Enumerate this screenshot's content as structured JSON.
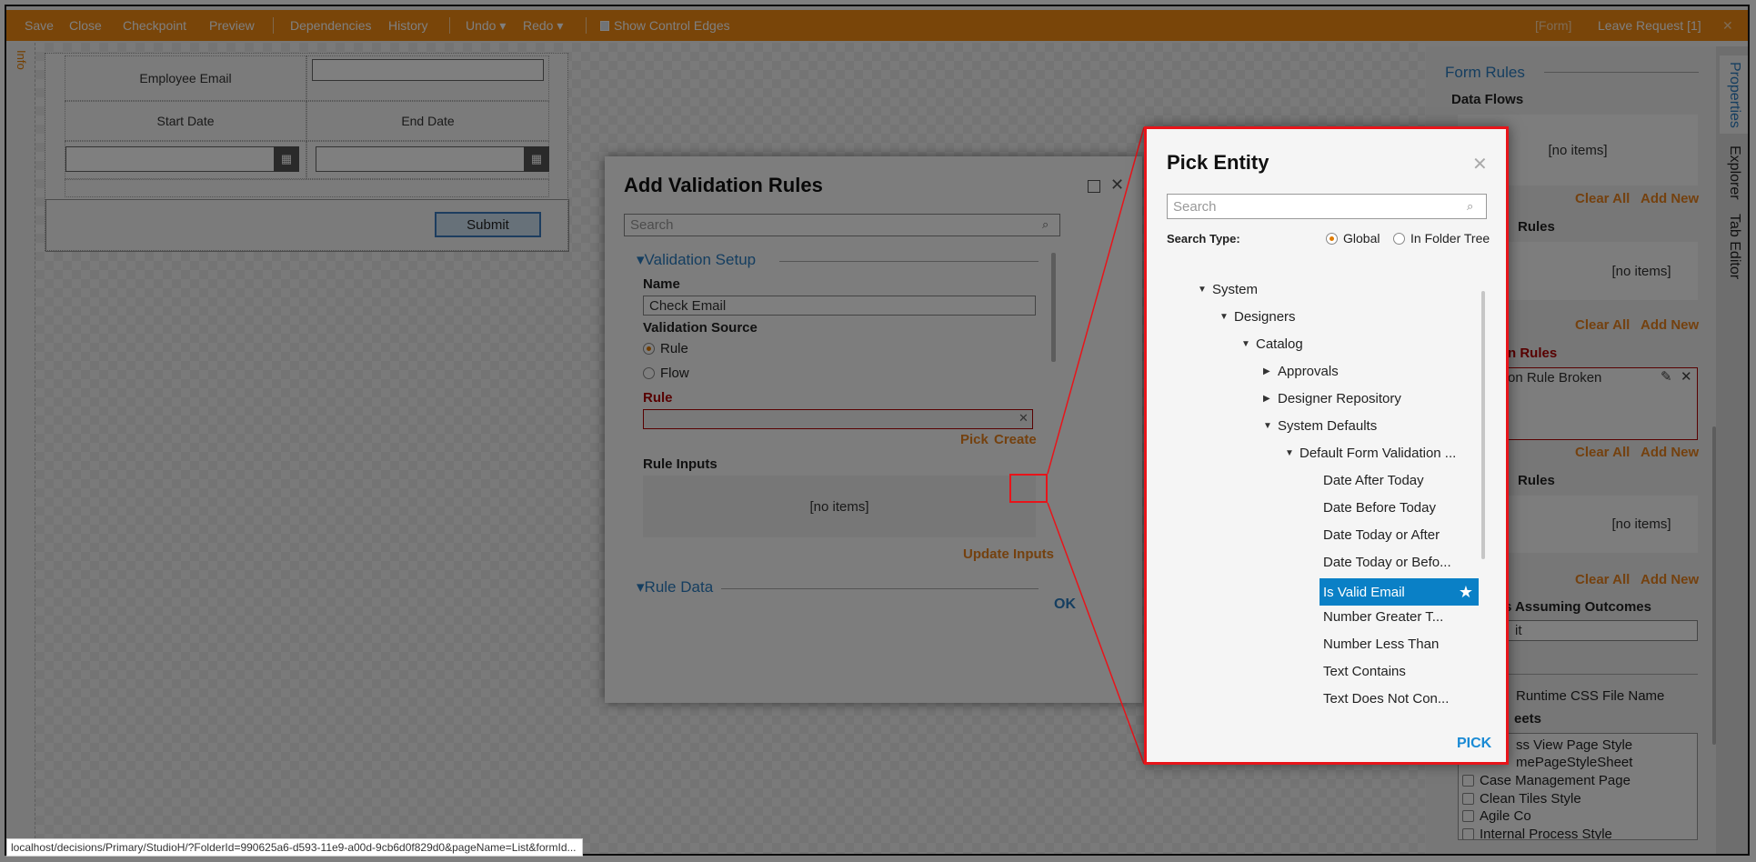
{
  "toolbar": {
    "save": "Save",
    "close": "Close",
    "checkpoint": "Checkpoint",
    "preview": "Preview",
    "dependencies": "Dependencies",
    "history": "History",
    "undo": "Undo ▾",
    "redo": "Redo ▾",
    "show_control_edges": "Show Control Edges",
    "form_tag": "[Form]",
    "doc_title": "Leave Request [1]",
    "close_icon": "✕"
  },
  "left_strip": {
    "info": "Info"
  },
  "form": {
    "employee_email": "Employee Email",
    "start_date": "Start Date",
    "end_date": "End Date",
    "submit": "Submit"
  },
  "right_panel": {
    "form_rules": "Form Rules",
    "data_flows": "Data Flows",
    "no_items": "[no items]",
    "clear_all": "Clear All",
    "add_new": "Add New",
    "rules_label_1": "Rules",
    "validation_rules_partial": "n Rules",
    "rule_broken_partial": "on Rule Broken",
    "rules_label_2": "Rules",
    "assuming_outcomes_partial": "s Assuming Outcomes",
    "assuming_value_partial": "it",
    "runtime_css": "Runtime CSS File Name",
    "stylesheets_partial": "eets",
    "stylesheets": [
      "ss View Page Style",
      "mePageStyleSheet",
      "Case Management Page",
      "Clean Tiles Style",
      "Agile Co",
      "Internal Process Style"
    ]
  },
  "right_tabs": {
    "properties": "Properties",
    "explorer": "Explorer",
    "tab_editor": "Tab Editor"
  },
  "validation_dialog": {
    "title": "Add Validation Rules",
    "search_placeholder": "Search",
    "validation_setup": "Validation Setup",
    "name_label": "Name",
    "name_value": "Check Email",
    "source_label": "Validation Source",
    "source_options": [
      "Rule",
      "Flow"
    ],
    "source_selected": "Rule",
    "rule_label": "Rule",
    "rule_value": "",
    "pick": "Pick",
    "create": "Create",
    "rule_inputs": "Rule Inputs",
    "no_items": "[no items]",
    "update_inputs": "Update Inputs",
    "rule_data": "Rule Data",
    "ok": "OK"
  },
  "pick_entity": {
    "title": "Pick Entity",
    "search_placeholder": "Search",
    "search_type_label": "Search Type:",
    "search_types": [
      "Global",
      "In Folder Tree"
    ],
    "search_type_selected": "Global",
    "tree": [
      {
        "label": "System",
        "level": 0,
        "state": "expanded"
      },
      {
        "label": "Designers",
        "level": 1,
        "state": "expanded"
      },
      {
        "label": "Catalog",
        "level": 2,
        "state": "expanded"
      },
      {
        "label": "Approvals",
        "level": 3,
        "state": "collapsed"
      },
      {
        "label": "Designer Repository",
        "level": 3,
        "state": "collapsed"
      },
      {
        "label": "System Defaults",
        "level": 3,
        "state": "expanded"
      },
      {
        "label": "Default Form Validation ...",
        "level": 4,
        "state": "expanded"
      },
      {
        "label": "Date After Today",
        "level": 5,
        "state": "leaf"
      },
      {
        "label": "Date Before Today",
        "level": 5,
        "state": "leaf"
      },
      {
        "label": "Date Today or After",
        "level": 5,
        "state": "leaf"
      },
      {
        "label": "Date Today or Befo...",
        "level": 5,
        "state": "leaf"
      },
      {
        "label": "Is Valid Email",
        "level": 5,
        "state": "leaf",
        "selected": true,
        "favorite": true
      },
      {
        "label": "Number Greater T...",
        "level": 5,
        "state": "leaf"
      },
      {
        "label": "Number Less Than",
        "level": 5,
        "state": "leaf"
      },
      {
        "label": "Text Contains",
        "level": 5,
        "state": "leaf"
      },
      {
        "label": "Text Does Not Con...",
        "level": 5,
        "state": "leaf"
      }
    ],
    "pick_button": "PICK"
  },
  "status_url": "localhost/decisions/Primary/StudioH/?FolderId=990625a6-d593-11e9-a00d-9cb6d0f829d0&pageName=List&formId...",
  "colors": {
    "toolbar": "#f28a12",
    "accent_orange": "#e8821e",
    "accent_blue": "#2a7cc0",
    "selected": "#0a80c6",
    "callout_red": "#e8141a",
    "error_red": "#b00000"
  }
}
